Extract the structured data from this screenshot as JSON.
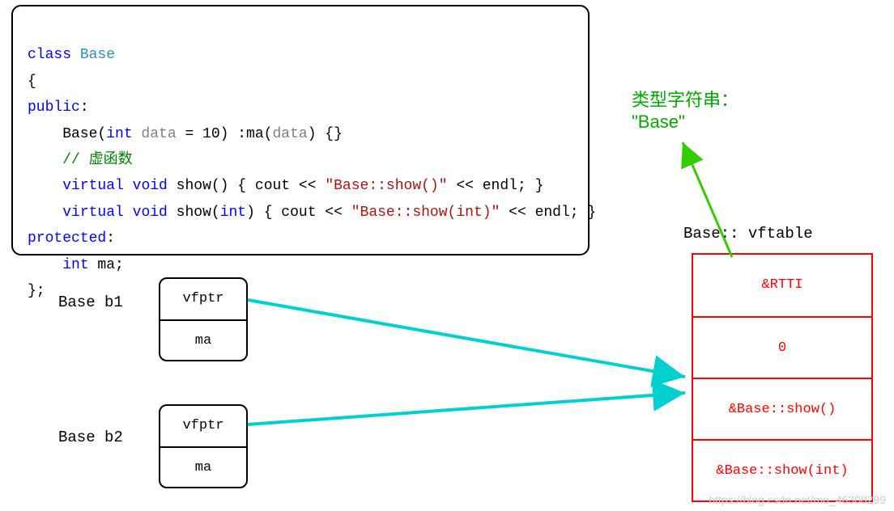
{
  "code": {
    "class_kw": "class",
    "class_name": "Base",
    "open_brace": "{",
    "public_kw": "public",
    "ctor_indent": "    Base(",
    "int_kw": "int",
    "ctor_param": " data",
    "ctor_rest": " = 10) :ma(",
    "ctor_arg": "data",
    "ctor_close": ") {}",
    "comment": "    // 虚函数",
    "virt1_a": "    ",
    "virtual_kw": "virtual",
    "void_kw": "void",
    "show1_sig": " show() { cout << ",
    "show1_str": "\"Base::show()\"",
    "show1_end": " << endl; }",
    "show2_sig": " show(",
    "show2_int": "int",
    "show2_mid": ") { cout << ",
    "show2_str": "\"Base::show(int)\"",
    "show2_end": " << endl; }",
    "protected_kw": "protected",
    "ma_decl_a": "    ",
    "ma_decl_b": " ma;",
    "close": "};"
  },
  "labels": {
    "b1": "Base b1",
    "b2": "Base b2",
    "vfptr": "vfptr",
    "ma": "ma",
    "vftable": "Base:: vftable"
  },
  "vftable": {
    "rtti": "&RTTI",
    "offset": "0",
    "show": "&Base::show()",
    "show_int": "&Base::show(int)"
  },
  "type_string": {
    "title": "类型字符串：",
    "value": "\"Base\""
  },
  "watermark": "https://blog.csdn.net/mo_46308299"
}
